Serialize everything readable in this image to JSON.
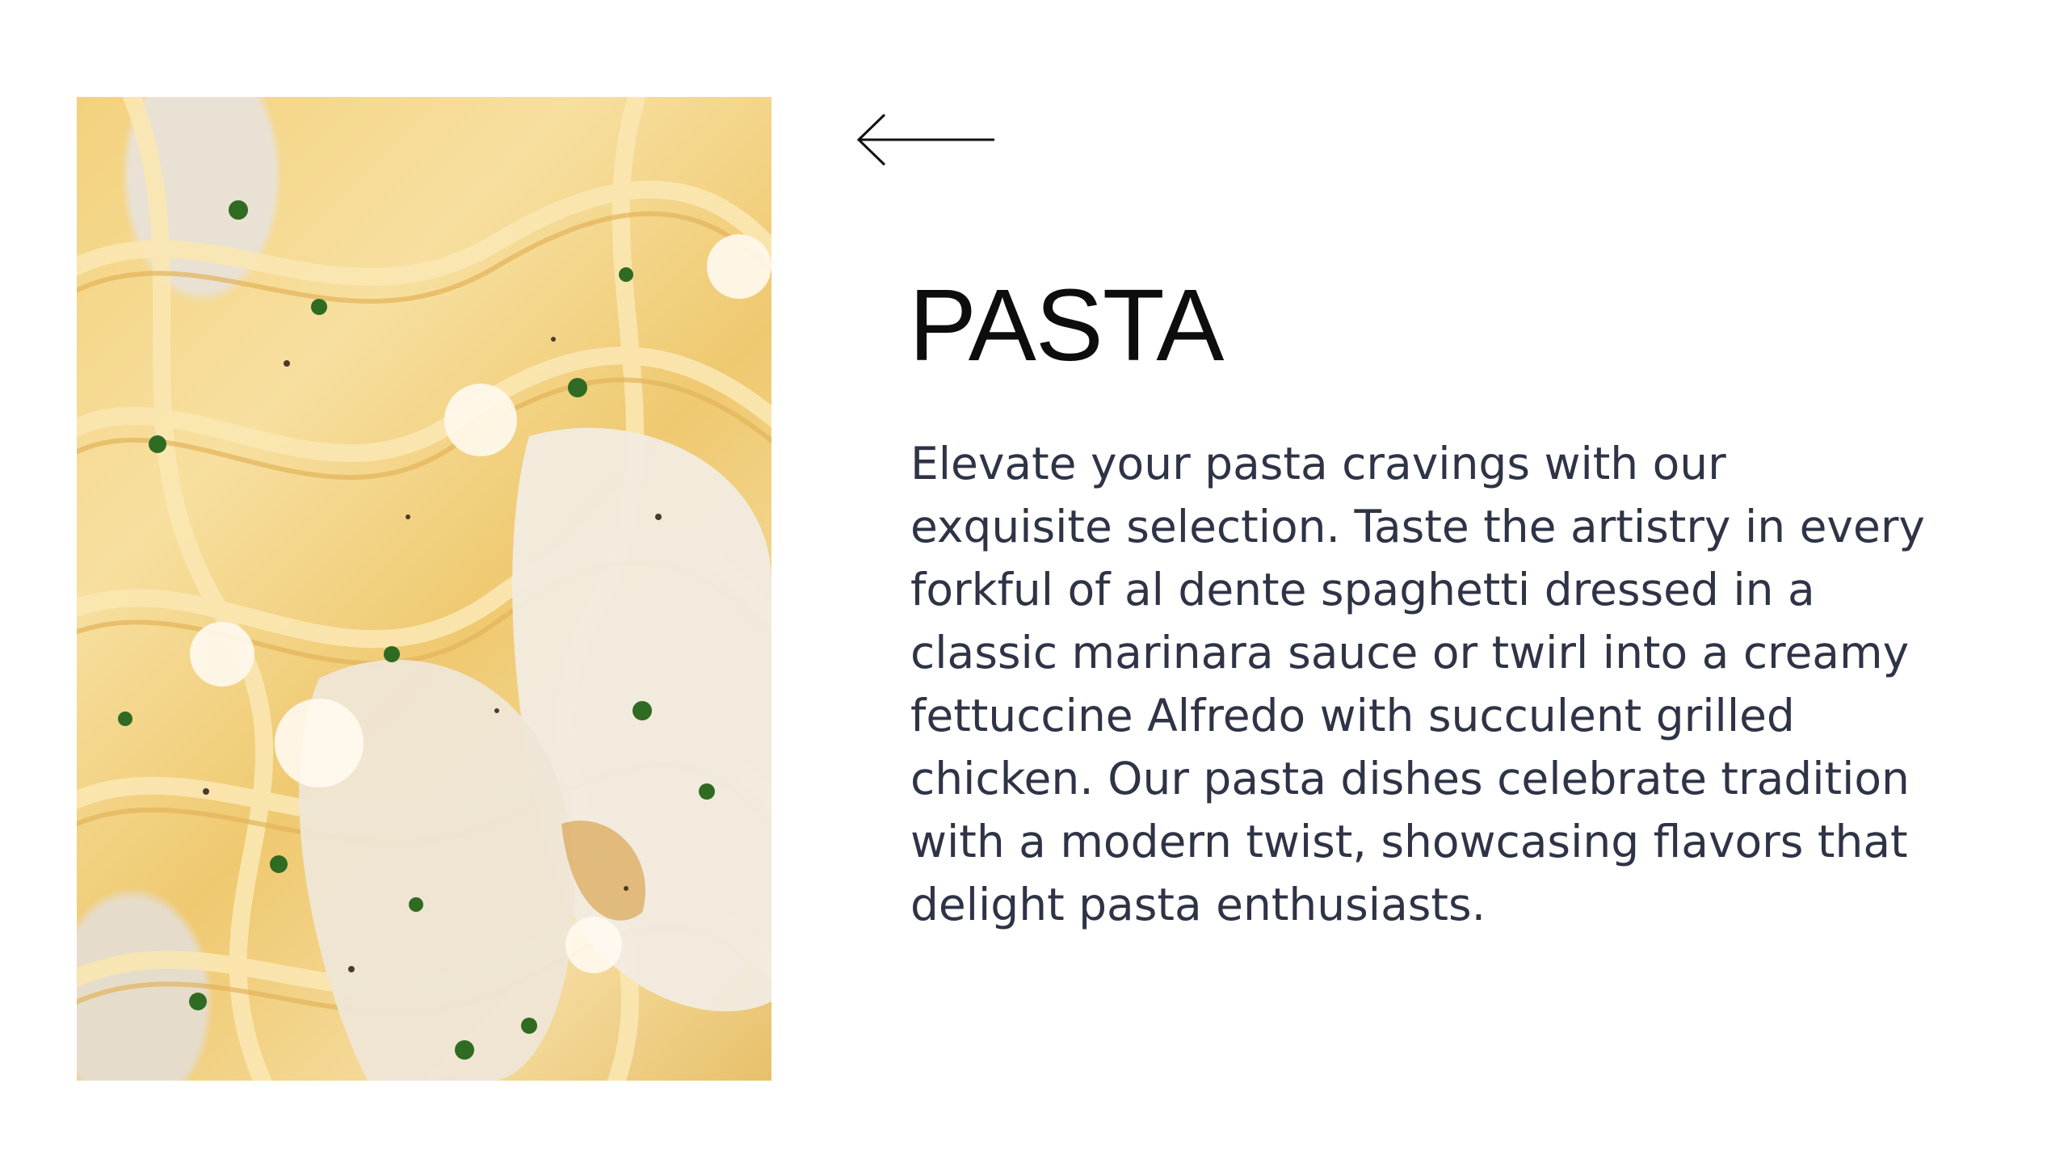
{
  "slide": {
    "title": "PASTA",
    "body": "Elevate your pasta cravings with our exquisite selection. Taste the artistry in every forkful of al dente spaghetti dressed in a classic marinara sauce or twirl into a creamy fettuccine Alfredo with succulent grilled chicken. Our pasta dishes celebrate tradition with a modern twist, showcasing flavors that delight pasta enthusiasts.",
    "back_icon": "arrow-left-icon",
    "image_icon": "pasta-photo"
  },
  "colors": {
    "background": "#ffffff",
    "title": "#0d0d0d",
    "body": "#2e3446",
    "arrow": "#111111"
  }
}
